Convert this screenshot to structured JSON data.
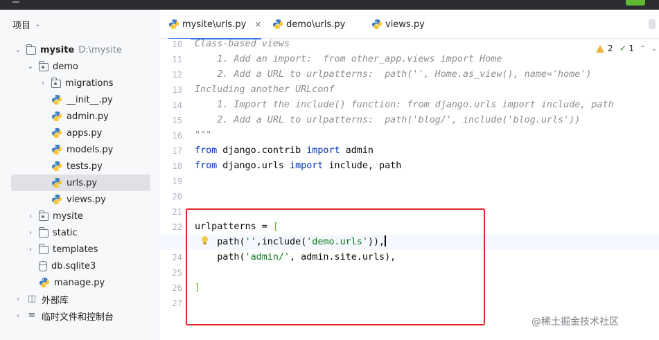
{
  "project_panel": {
    "title": "项目",
    "tree": [
      {
        "label": "mysite",
        "hint": "D:\\mysite",
        "type": "folder",
        "expanded": true
      },
      {
        "label": "demo",
        "type": "package",
        "expanded": true
      },
      {
        "label": "migrations",
        "type": "package",
        "expanded": false
      },
      {
        "label": "__init__.py",
        "type": "python"
      },
      {
        "label": "admin.py",
        "type": "python"
      },
      {
        "label": "apps.py",
        "type": "python"
      },
      {
        "label": "models.py",
        "type": "python"
      },
      {
        "label": "tests.py",
        "type": "python"
      },
      {
        "label": "urls.py",
        "type": "python",
        "selected": true
      },
      {
        "label": "views.py",
        "type": "python"
      },
      {
        "label": "mysite",
        "type": "package",
        "expanded": false
      },
      {
        "label": "static",
        "type": "folder",
        "expanded": false
      },
      {
        "label": "templates",
        "type": "folder",
        "expanded": false
      },
      {
        "label": "db.sqlite3",
        "type": "database"
      },
      {
        "label": "manage.py",
        "type": "python"
      },
      {
        "label": "外部库",
        "type": "library",
        "expanded": false
      },
      {
        "label": "临时文件和控制台",
        "type": "scratches",
        "expanded": false
      }
    ]
  },
  "editor": {
    "tabs": [
      {
        "label": "mysite\\urls.py",
        "active": true,
        "close": "×"
      },
      {
        "label": "demo\\urls.py",
        "active": false
      },
      {
        "label": "views.py",
        "active": false
      }
    ],
    "inspections": {
      "warnings": "2",
      "weak_warnings": "1"
    },
    "lines": [
      {
        "num": "10",
        "text": "Class-based views"
      },
      {
        "num": "11",
        "text": "    1. Add an import:  from other_app.views import Home"
      },
      {
        "num": "12",
        "text": "    2. Add a URL to urlpatterns:  path('', Home.as_view(), name='home')"
      },
      {
        "num": "13",
        "text": "Including another URLconf"
      },
      {
        "num": "14",
        "text": "    1. Import the include() function: from django.urls import include, path"
      },
      {
        "num": "15",
        "text": "    2. Add a URL to urlpatterns:  path('blog/', include('blog.urls'))"
      },
      {
        "num": "16",
        "text": "\"\"\""
      },
      {
        "num": "17",
        "parts": [
          "from",
          " django.contrib ",
          "import",
          " admin"
        ]
      },
      {
        "num": "18",
        "parts": [
          "from",
          " django.urls ",
          "import",
          " include, path"
        ]
      },
      {
        "num": "19",
        "text": ""
      },
      {
        "num": "20",
        "text": ""
      },
      {
        "num": "21",
        "text": ""
      },
      {
        "num": "22",
        "parts": [
          "urlpatterns = ",
          "["
        ]
      },
      {
        "num": "23",
        "parts": [
          "    path(",
          "''",
          ",include(",
          "'demo.urls'",
          ")),"
        ]
      },
      {
        "num": "24",
        "parts": [
          "    path(",
          "'admin/'",
          ", admin.site.urls),"
        ]
      },
      {
        "num": "25",
        "text": ""
      },
      {
        "num": "26",
        "parts": [
          "]"
        ]
      },
      {
        "num": "27",
        "text": ""
      }
    ]
  },
  "watermark": "@稀土掘金技术社区",
  "colors": {
    "keyword": "#0033b3",
    "string": "#067d17",
    "doc_comment": "#8c8c8c",
    "highlight_box": "#e0282a",
    "active_tab_underline": "#3574f0"
  }
}
